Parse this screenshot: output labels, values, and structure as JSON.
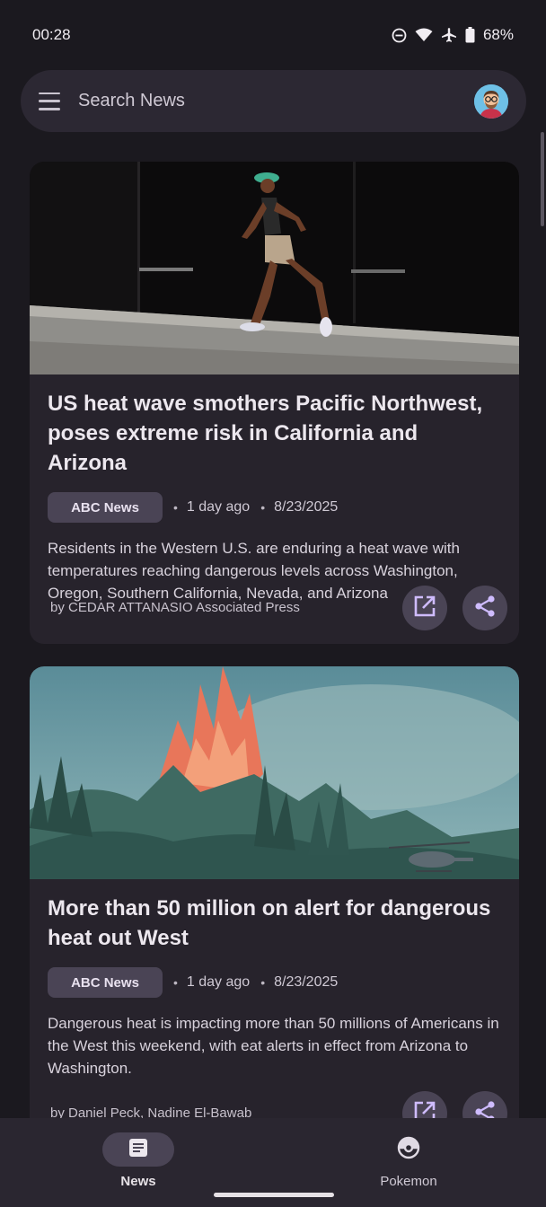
{
  "status_bar": {
    "time": "00:28",
    "battery": "68%",
    "icons": [
      "do-not-disturb-icon",
      "wifi-icon",
      "airplane-icon",
      "battery-icon"
    ]
  },
  "search": {
    "placeholder": "Search News"
  },
  "articles": [
    {
      "title": "US heat wave smothers Pacific Northwest, poses extreme risk in California and Arizona",
      "source": "ABC News",
      "relative_time": "1 day ago",
      "date": "8/23/2025",
      "description": "Residents in the Western U.S. are enduring a heat wave with temperatures reaching dangerous levels across Washington, Oregon, Southern California, Nevada, and Arizona",
      "byline": "by CEDAR ATTANASIO Associated Press"
    },
    {
      "title": "More than 50 million on alert for dangerous heat out West",
      "source": "ABC News",
      "relative_time": "1 day ago",
      "date": "8/23/2025",
      "description": "Dangerous heat is impacting more than 50 millions of Americans in the West this weekend, with eat alerts in effect from Arizona to Washington.",
      "byline": "by Daniel Peck, Nadine El-Bawab"
    }
  ],
  "nav": {
    "news_label": "News",
    "pokemon_label": "Pokemon",
    "selected": "News"
  },
  "colors": {
    "background": "#1b191f",
    "card": "#27232c",
    "chip": "#4a4455",
    "accent_icon": "#cfbcff"
  }
}
